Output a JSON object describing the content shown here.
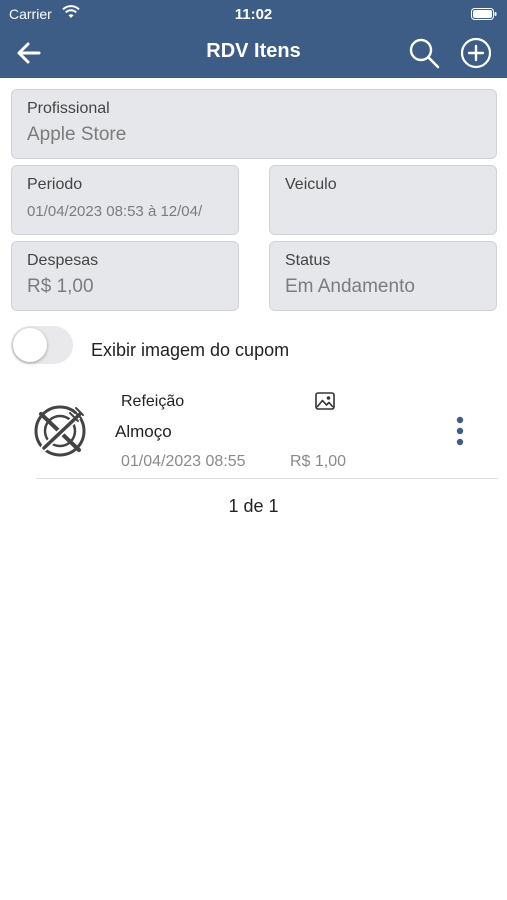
{
  "status_bar": {
    "carrier": "Carrier",
    "time": "11:02"
  },
  "header": {
    "title": "RDV Itens",
    "icons": [
      "back-arrow-icon",
      "search-icon",
      "add-circle-icon"
    ]
  },
  "fields": {
    "profissional": {
      "label": "Profissional",
      "value": "Apple Store"
    },
    "periodo": {
      "label": "Periodo",
      "value": "01/04/2023 08:53 à 12/04/"
    },
    "veiculo": {
      "label": "Veiculo",
      "value": ""
    },
    "despesas": {
      "label": "Despesas",
      "value": "R$ 1,00"
    },
    "status": {
      "label": "Status",
      "value": "Em Andamento"
    }
  },
  "toggle": {
    "label": "Exibir imagem do cupom",
    "on": false
  },
  "items": [
    {
      "category": "Refeição",
      "name": "Almoço",
      "date": "01/04/2023 08:55",
      "amount": "R$ 1,00",
      "icon": "plate-fork-knife-icon"
    }
  ],
  "pagination": "1 de 1",
  "colors": {
    "header": "#3d5d86",
    "field_bg": "#e6e7ea",
    "accent": "#3d5d86"
  }
}
